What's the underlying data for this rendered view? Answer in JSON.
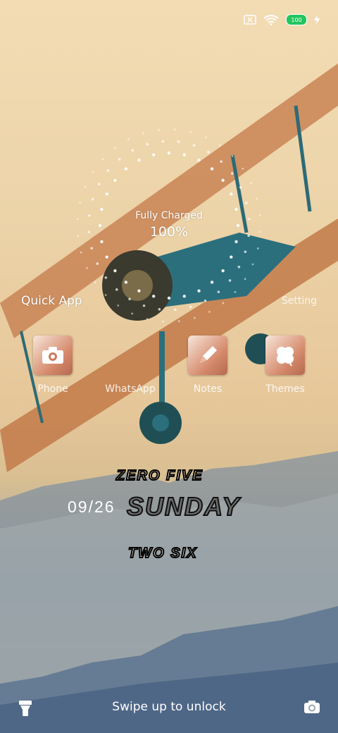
{
  "status_bar": {
    "battery_level": "100",
    "icons": [
      "no-sim-icon",
      "wifi-icon",
      "battery-icon",
      "charging-bolt-icon"
    ]
  },
  "charging": {
    "title": "Fully Charged",
    "percent": "100%"
  },
  "quick_apps": {
    "label": "Quick App",
    "setting_label": "Setting",
    "apps": [
      {
        "name": "Phone",
        "icon": "camera-icon"
      },
      {
        "name": "WhatsApp",
        "icon": ""
      },
      {
        "name": "Notes",
        "icon": "pencil-icon"
      },
      {
        "name": "Themes",
        "icon": "clover-icon"
      }
    ]
  },
  "clock": {
    "line1": "ZERO FIVE",
    "date": "09/26",
    "day": "SUNDAY",
    "line3": "TWO SIX"
  },
  "bottom": {
    "unlock_text": "Swipe up to unlock",
    "left_icon": "flashlight-icon",
    "right_icon": "camera-icon"
  },
  "colors": {
    "battery": "#22c55e",
    "app_icon": "#d5896b"
  }
}
